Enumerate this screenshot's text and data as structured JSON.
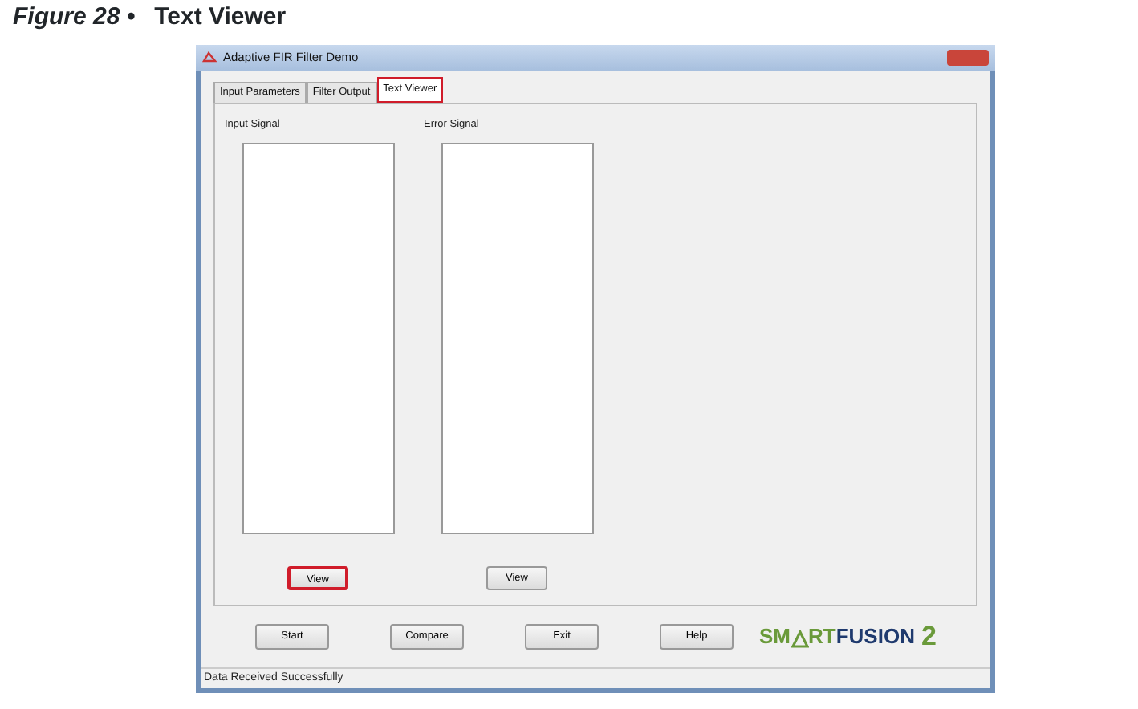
{
  "caption": {
    "number": "Figure 28 •",
    "title": "Text Viewer"
  },
  "window": {
    "title": "Adaptive FIR Filter Demo"
  },
  "tabs": [
    {
      "label": "Input Parameters",
      "selected": false,
      "highlighted": false
    },
    {
      "label": "Filter Output",
      "selected": false,
      "highlighted": false
    },
    {
      "label": "Text Viewer",
      "selected": true,
      "highlighted": true
    }
  ],
  "panels": [
    {
      "label": "Input Signal",
      "button": "View",
      "highlighted": true
    },
    {
      "label": "Error Signal",
      "button": "View",
      "highlighted": false
    }
  ],
  "buttons": [
    "Start",
    "Compare",
    "Exit",
    "Help"
  ],
  "logo": [
    {
      "text": "SM",
      "color": "#6a9a3a"
    },
    {
      "text": "RT",
      "color": "#6a9a3a"
    },
    {
      "text": "FUSION",
      "color": "#1f3a6e"
    },
    {
      "text": "2",
      "color": "#6a9a3a"
    }
  ],
  "status_bar": "Data Received Successfully"
}
